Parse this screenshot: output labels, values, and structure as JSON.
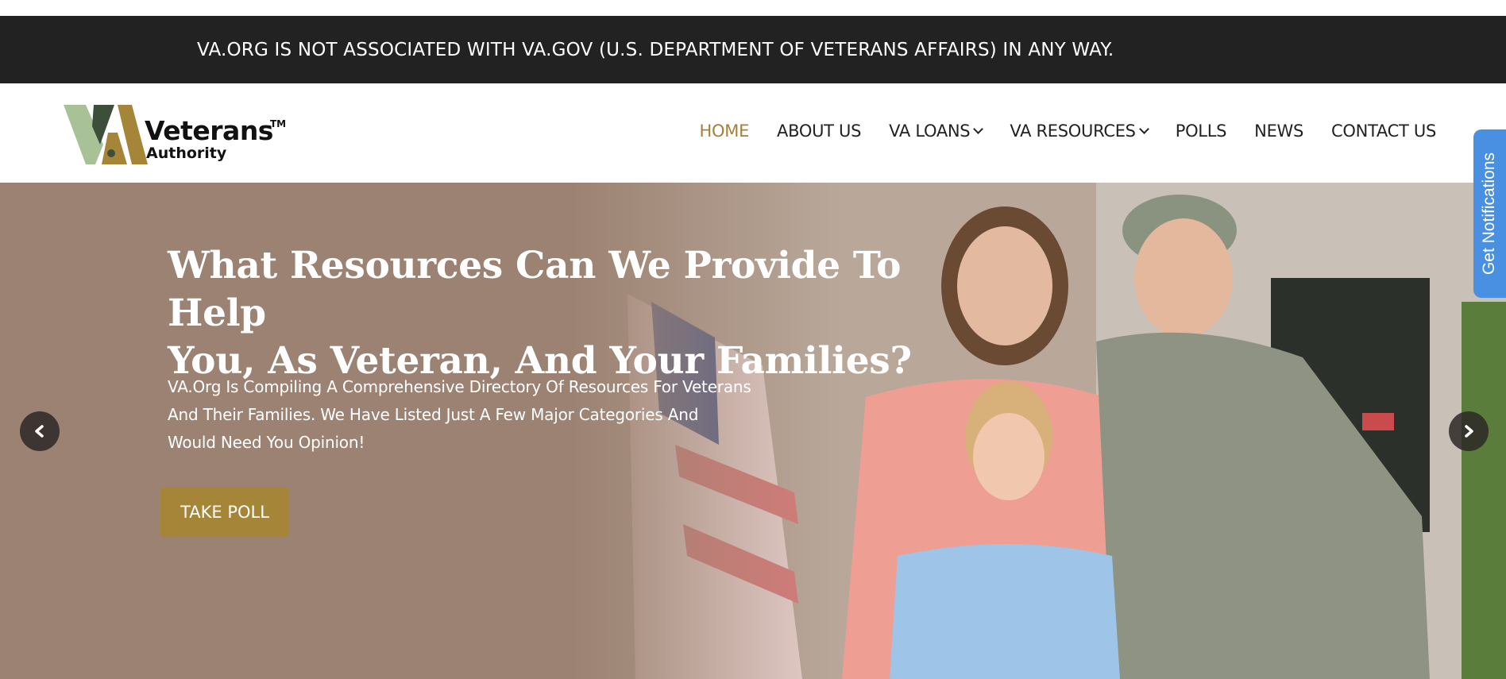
{
  "disclaimer": {
    "text": "VA.ORG IS NOT ASSOCIATED WITH VA.GOV (U.S. DEPARTMENT OF VETERANS AFFAIRS) IN ANY WAY."
  },
  "logo": {
    "main": "Veterans",
    "tm": "TM",
    "sub": "Authority"
  },
  "nav": {
    "items": [
      {
        "label": "HOME",
        "active": true
      },
      {
        "label": "ABOUT US"
      },
      {
        "label": "VA LOANS",
        "dropdown": true
      },
      {
        "label": "VA RESOURCES",
        "dropdown": true
      },
      {
        "label": "POLLS"
      },
      {
        "label": "NEWS"
      },
      {
        "label": "CONTACT US"
      }
    ]
  },
  "hero": {
    "title_line1": "What Resources Can We Provide To Help",
    "title_line2": "You, As Veteran, And Your Families?",
    "desc_line1": "VA.Org Is Compiling A Comprehensive Directory Of Resources For Veterans",
    "desc_line2": "And Their Families. We Have Listed Just A Few Major Categories And",
    "desc_line3": "Would Need You Opinion!",
    "cta": "TAKE POLL"
  },
  "notifications_tab": {
    "label": "Get Notifications"
  },
  "colors": {
    "topbar": "#222222",
    "accent_gold": "#a58638",
    "nav_active": "#a4803a",
    "hero_bg": "#9c8272",
    "notif_blue": "#4a90e2"
  },
  "icons": {
    "prev": "chevron-left-icon",
    "next": "chevron-right-icon",
    "dropdown": "chevron-down-icon"
  }
}
